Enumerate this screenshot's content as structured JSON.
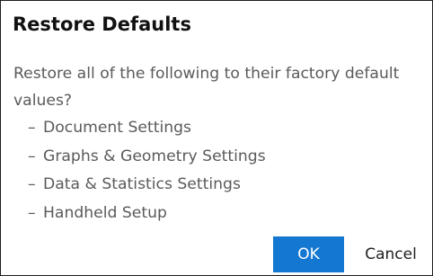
{
  "dialog": {
    "title": "Restore Defaults",
    "message": "Restore all of the following to their factory default values?",
    "items": [
      "Document Settings",
      "Graphs & Geometry Settings",
      "Data & Statistics Settings",
      "Handheld Setup"
    ],
    "ok_label": "OK",
    "cancel_label": "Cancel"
  },
  "colors": {
    "accent": "#1478d2",
    "border": "#1e1e1e",
    "text_secondary": "#5a5a5a"
  }
}
